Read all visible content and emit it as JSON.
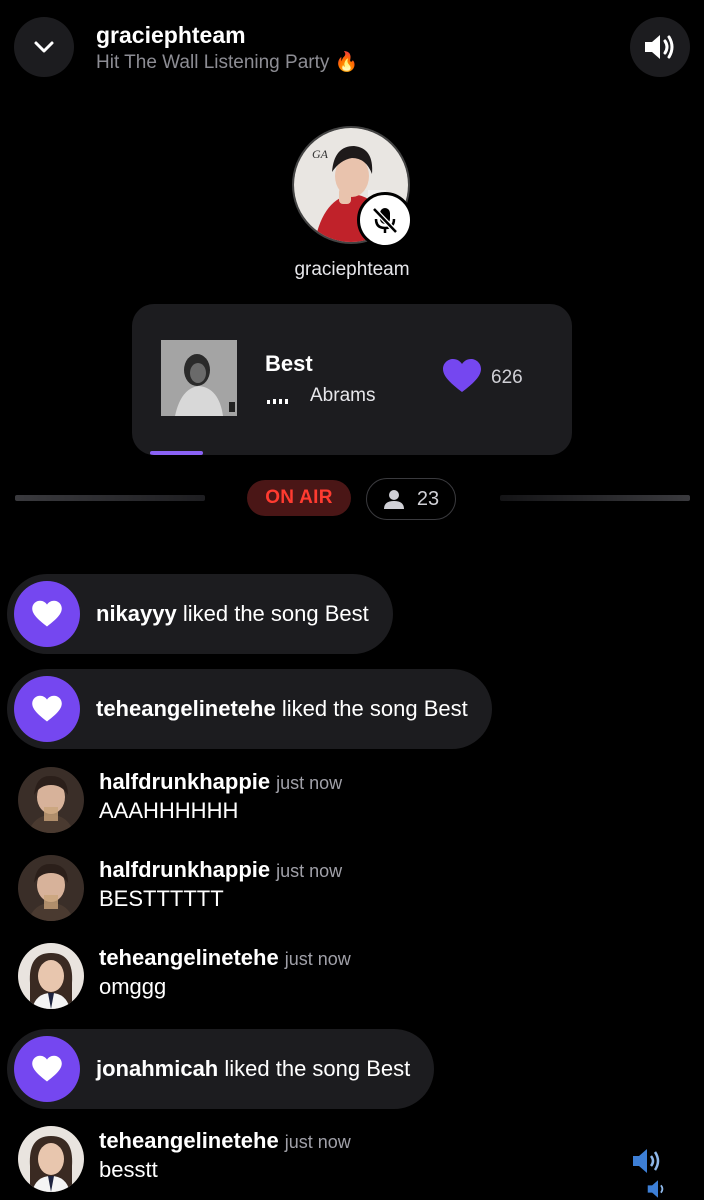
{
  "header": {
    "host": "graciephteam",
    "room_title": "Hit The Wall Listening Party 🔥"
  },
  "host_card": {
    "name": "graciephteam"
  },
  "now_playing": {
    "title": "Best",
    "artist": "Abrams",
    "likes": "626",
    "progress_fraction": 0.13,
    "accent_color": "#8a62f5"
  },
  "status": {
    "on_air_label": "ON AIR",
    "listener_count": "23"
  },
  "feed": [
    {
      "kind": "like",
      "user": "nikayyy",
      "text": " liked the song Best"
    },
    {
      "kind": "like",
      "user": "teheangelinetehe",
      "text": " liked the song Best"
    },
    {
      "kind": "chat",
      "user": "halfdrunkhappie",
      "time": "just now",
      "text": "AAAHHHHHH"
    },
    {
      "kind": "chat",
      "user": "halfdrunkhappie",
      "time": "just now",
      "text": "BESTTTTTT"
    },
    {
      "kind": "chat",
      "user": "teheangelinetehe",
      "time": "just now",
      "text": "omggg"
    },
    {
      "kind": "like",
      "user": "jonahmicah",
      "text": " liked the song Best"
    },
    {
      "kind": "chat",
      "user": "teheangelinetehe",
      "time": "just now",
      "text": "besstt"
    }
  ],
  "colors": {
    "like_purple": "#7547f0",
    "on_air_red": "#ff3b30",
    "panel": "#1c1c1f"
  },
  "icons": [
    "chevron-down-icon",
    "speaker-icon",
    "mic-off-icon",
    "heart-icon",
    "person-icon"
  ]
}
